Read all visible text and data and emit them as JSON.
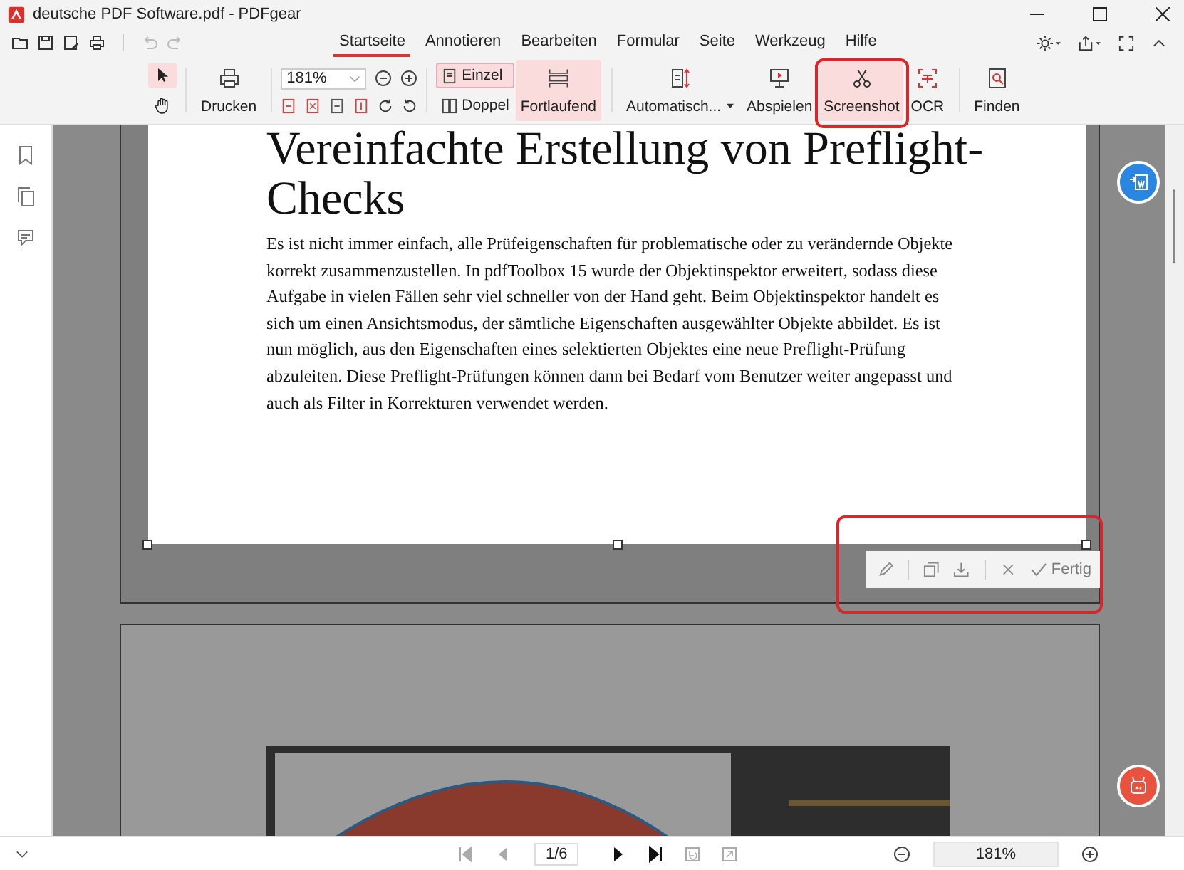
{
  "window": {
    "title": "deutsche PDF Software.pdf - PDFgear"
  },
  "quick_access": [
    {
      "kind": "open",
      "disabled": false
    },
    {
      "kind": "save",
      "disabled": false
    },
    {
      "kind": "save-as",
      "disabled": false
    },
    {
      "kind": "print",
      "disabled": false
    },
    {
      "kind": "undo",
      "disabled": true
    },
    {
      "kind": "redo",
      "disabled": true
    }
  ],
  "menu_tabs": [
    {
      "label": "Startseite",
      "selected": true
    },
    {
      "label": "Annotieren",
      "selected": false
    },
    {
      "label": "Bearbeiten",
      "selected": false
    },
    {
      "label": "Formular",
      "selected": false
    },
    {
      "label": "Seite",
      "selected": false
    },
    {
      "label": "Werkzeug",
      "selected": false
    },
    {
      "label": "Hilfe",
      "selected": false
    }
  ],
  "ribbon": {
    "tools": [
      {
        "kind": "pointer",
        "selected": true
      },
      {
        "kind": "hand",
        "selected": false
      }
    ],
    "print": {
      "label": "Drucken"
    },
    "zoom": {
      "value": "181%"
    },
    "view_modes": [
      {
        "label": "Einzel",
        "selected": true
      },
      {
        "label": "Doppel",
        "selected": false
      }
    ],
    "scroll_mode": {
      "label": "Fortlaufend",
      "selected": true
    },
    "actions": [
      {
        "kind": "auto",
        "label": "Automatisch...",
        "dropdown": true,
        "selected": false
      },
      {
        "kind": "play",
        "label": "Abspielen",
        "dropdown": false,
        "selected": false
      },
      {
        "kind": "scissors",
        "label": "Screenshot",
        "dropdown": false,
        "selected": true
      },
      {
        "kind": "ocr",
        "label": "OCR",
        "dropdown": false,
        "selected": false
      }
    ],
    "find": {
      "label": "Finden"
    }
  },
  "document": {
    "heading": "Vereinfachte Erstellung von Preflight-Checks",
    "paragraph": "Es ist nicht immer einfach, alle Prüfeigenschaften für problematische oder zu verändernde Objekte korrekt zusammenzustellen. In pdfToolbox 15 wurde der Objektinspektor erweitert, sodass diese Aufgabe in vielen Fällen sehr viel schneller von der Hand geht. Beim Objektinspektor handelt es sich um einen Ansichtsmodus, der sämtliche Eigenschaften ausgewählter Objekte abbildet. Es ist nun möglich, aus den Eigenschaften eines selektierten Objektes eine neue Preflight-Prüfung abzuleiten. Diese Preflight-Prüfungen können dann bei Bedarf vom Benutzer weiter angepasst und auch als Filter in Korrekturen verwendet werden."
  },
  "selection_toolbar": {
    "done_label": "Fertig"
  },
  "status_bar": {
    "nav": [
      {
        "kind": "first",
        "disabled": true
      },
      {
        "kind": "prev",
        "disabled": true
      }
    ],
    "page": "1/6",
    "nav_after": [
      {
        "kind": "next",
        "disabled": false
      },
      {
        "kind": "last",
        "disabled": false
      },
      {
        "kind": "rotate-left",
        "disabled": true
      },
      {
        "kind": "rotate-right",
        "disabled": true
      }
    ],
    "zoom": "181%"
  }
}
